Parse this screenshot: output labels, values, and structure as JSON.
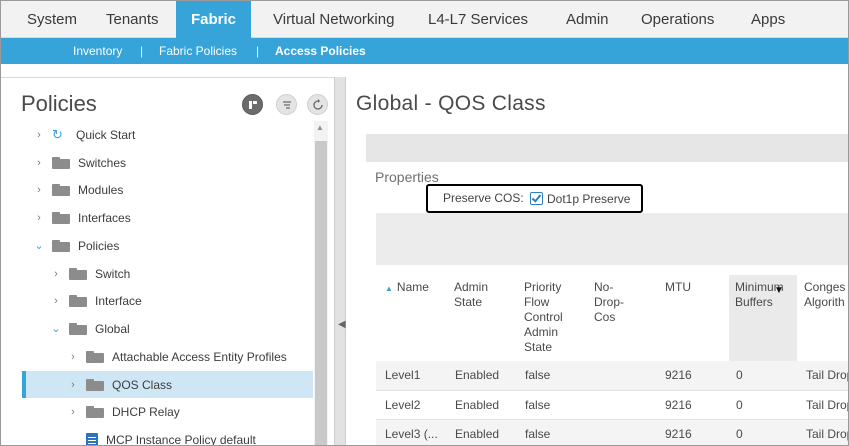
{
  "topnav": {
    "tabs": [
      "System",
      "Tenants",
      "Fabric",
      "Virtual Networking",
      "L4-L7 Services",
      "Admin",
      "Operations",
      "Apps"
    ],
    "active": "Fabric"
  },
  "subnav": {
    "items": [
      "Inventory",
      "Fabric Policies",
      "Access Policies"
    ],
    "separator": "|",
    "active": "Access Policies"
  },
  "left": {
    "title": "Policies",
    "tree": [
      {
        "label": "Quick Start",
        "chev": "›"
      },
      {
        "label": "Switches",
        "chev": "›"
      },
      {
        "label": "Modules",
        "chev": "›"
      },
      {
        "label": "Interfaces",
        "chev": "›"
      },
      {
        "label": "Policies",
        "chev": "⌄"
      },
      {
        "label": "Switch",
        "chev": "›"
      },
      {
        "label": "Interface",
        "chev": "›"
      },
      {
        "label": "Global",
        "chev": "⌄"
      },
      {
        "label": "Attachable Access Entity Profiles",
        "chev": "›"
      },
      {
        "label": "QOS Class",
        "chev": "›"
      },
      {
        "label": "DHCP Relay",
        "chev": "›"
      },
      {
        "label": "MCP Instance Policy default",
        "chev": ""
      }
    ]
  },
  "right": {
    "title": "Global - QOS Class",
    "properties_label": "Properties",
    "preserve_cos_label": "Preserve COS:",
    "dot1p_label": "Dot1p Preserve",
    "dot1p_checked": true,
    "columns": [
      {
        "label": "Name"
      },
      {
        "label": "Admin\nState"
      },
      {
        "label": "Priority\nFlow\nControl\nAdmin\nState"
      },
      {
        "label": "No-\nDrop-\nCos"
      },
      {
        "label": "MTU"
      },
      {
        "label": "Minimum\nBuffers"
      },
      {
        "label": "Conges\nAlgorith"
      }
    ],
    "rows": [
      [
        "Level1",
        "Enabled",
        "false",
        "",
        "9216",
        "0",
        "Tail Drop"
      ],
      [
        "Level2",
        "Enabled",
        "false",
        "",
        "9216",
        "0",
        "Tail Drop"
      ],
      [
        "Level3 (...",
        "Enabled",
        "false",
        "",
        "9216",
        "0",
        "Tail Drop"
      ]
    ]
  },
  "colors": {
    "accent": "#36a3d9",
    "selection": "#cfe7f5",
    "folder": "#8c8c8c"
  },
  "icons": [
    "refresh-icon",
    "folder-icon",
    "policy-doc-icon",
    "sort-ascending-icon",
    "checkmark-icon",
    "quick-start-icon"
  ]
}
